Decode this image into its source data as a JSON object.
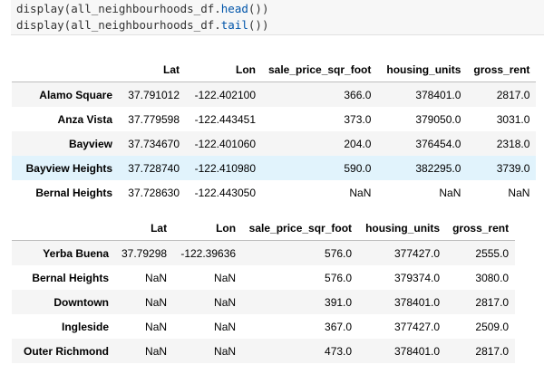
{
  "code": {
    "line1_prefix": "display(all_neighbourhoods_df.",
    "line1_fn": "head",
    "line1_suffix": "())",
    "line2_prefix": "display(all_neighbourhoods_df.",
    "line2_fn": "tail",
    "line2_suffix": "())"
  },
  "head_table": {
    "columns": [
      "",
      "Lat",
      "Lon",
      "sale_price_sqr_foot",
      "housing_units",
      "gross_rent"
    ],
    "rows": [
      {
        "index": "Alamo Square",
        "cells": [
          "37.791012",
          "-122.402100",
          "366.0",
          "378401.0",
          "2817.0"
        ]
      },
      {
        "index": "Anza Vista",
        "cells": [
          "37.779598",
          "-122.443451",
          "373.0",
          "379050.0",
          "3031.0"
        ]
      },
      {
        "index": "Bayview",
        "cells": [
          "37.734670",
          "-122.401060",
          "204.0",
          "376454.0",
          "2318.0"
        ]
      },
      {
        "index": "Bayview Heights",
        "cells": [
          "37.728740",
          "-122.410980",
          "590.0",
          "382295.0",
          "3739.0"
        ]
      },
      {
        "index": "Bernal Heights",
        "cells": [
          "37.728630",
          "-122.443050",
          "NaN",
          "NaN",
          "NaN"
        ]
      }
    ]
  },
  "tail_table": {
    "columns": [
      "",
      "Lat",
      "Lon",
      "sale_price_sqr_foot",
      "housing_units",
      "gross_rent"
    ],
    "rows": [
      {
        "index": "Yerba Buena",
        "cells": [
          "37.79298",
          "-122.39636",
          "576.0",
          "377427.0",
          "2555.0"
        ]
      },
      {
        "index": "Bernal Heights",
        "cells": [
          "NaN",
          "NaN",
          "576.0",
          "379374.0",
          "3080.0"
        ]
      },
      {
        "index": "Downtown",
        "cells": [
          "NaN",
          "NaN",
          "391.0",
          "378401.0",
          "2817.0"
        ]
      },
      {
        "index": "Ingleside",
        "cells": [
          "NaN",
          "NaN",
          "367.0",
          "377427.0",
          "2509.0"
        ]
      },
      {
        "index": "Outer Richmond",
        "cells": [
          "NaN",
          "NaN",
          "473.0",
          "378401.0",
          "2817.0"
        ]
      }
    ]
  },
  "colors": {
    "code_background": "#f7f7f7",
    "function_name": "#0055aa",
    "row_stripe": "#f5f5f5",
    "row_hover": "#e1f3fc"
  }
}
